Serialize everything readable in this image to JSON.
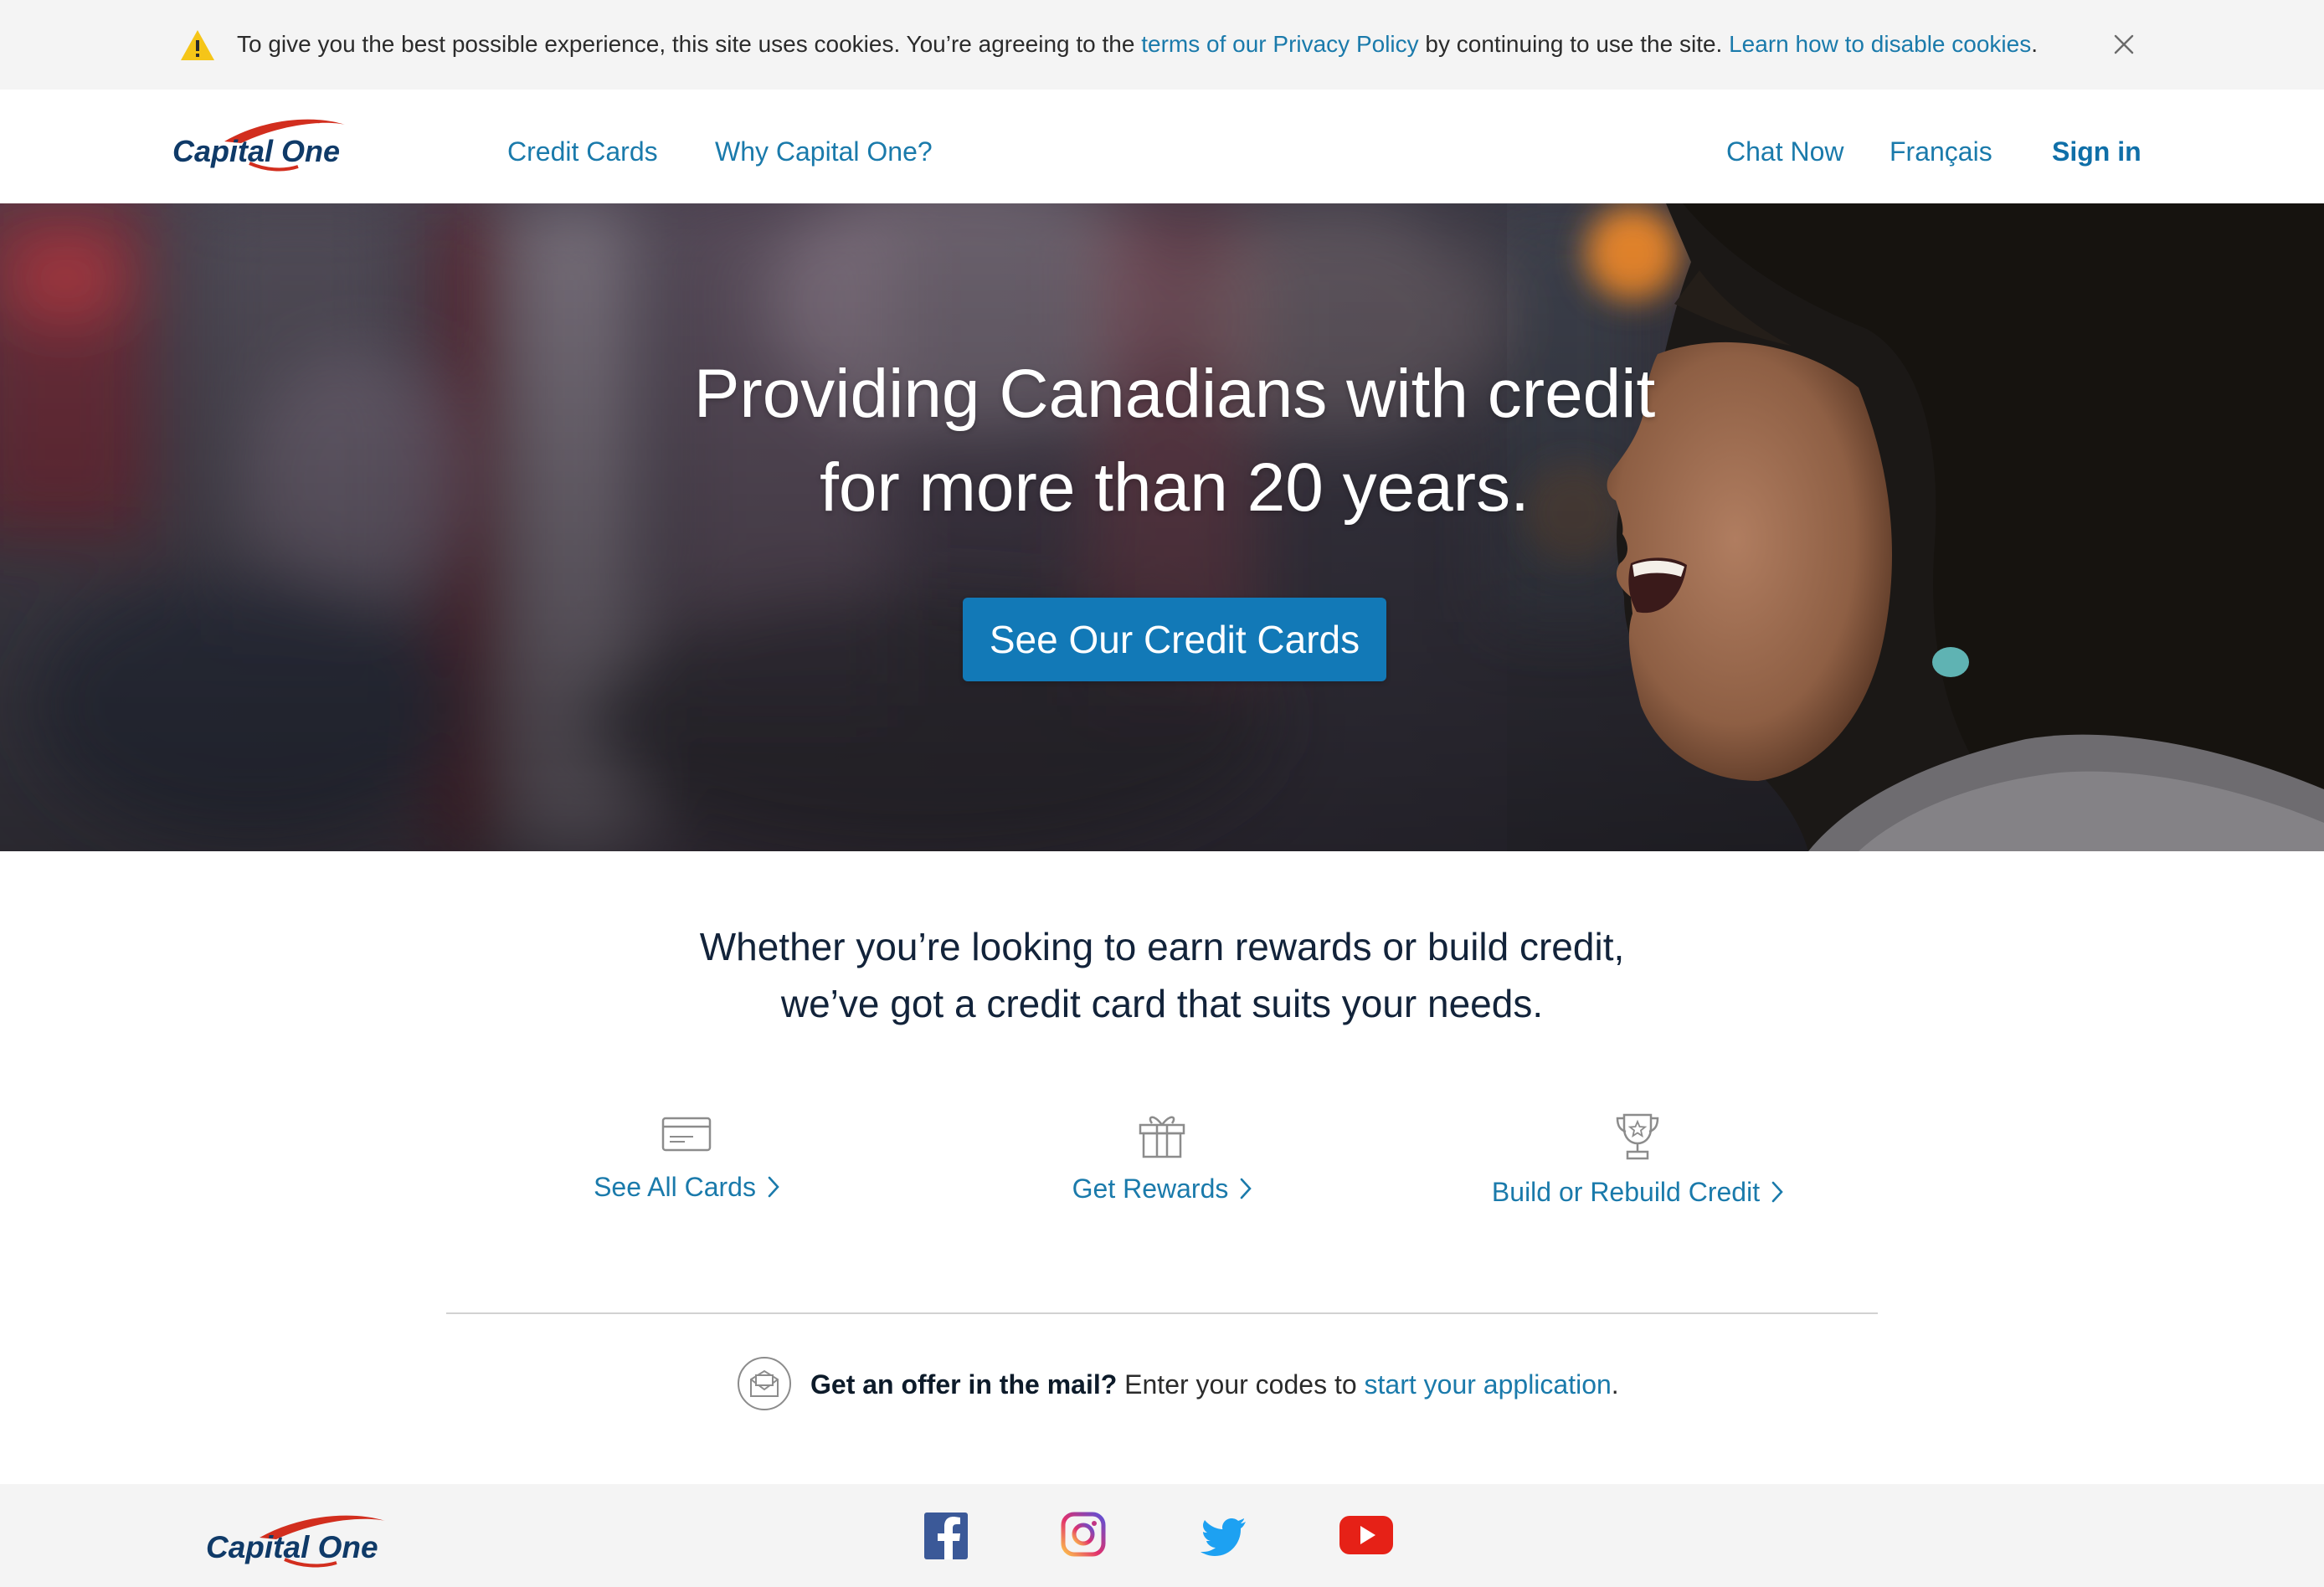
{
  "cookie_banner": {
    "text_before": "To give you the best possible experience, this site uses cookies. You’re agreeing to the ",
    "privacy_link": "terms of our Privacy Policy",
    "text_middle": " by continuing to use the site. ",
    "disable_link": "Learn how to disable cookies",
    "text_end": "."
  },
  "header": {
    "logo_text": "Capital One",
    "nav": {
      "credit_cards": "Credit Cards",
      "why_capital_one": "Why Capital One?"
    },
    "utility": {
      "chat_now": "Chat Now",
      "language": "Français",
      "sign_in": "Sign in"
    }
  },
  "hero": {
    "title_line1": "Providing Canadians with credit",
    "title_line2": "for more than 20 years.",
    "cta": "See Our Credit Cards"
  },
  "intro": {
    "line1": "Whether you’re looking to earn rewards or build credit,",
    "line2": "we’ve got a credit card that suits your needs."
  },
  "features": [
    {
      "label": "See All Cards",
      "icon": "credit-card-icon"
    },
    {
      "label": "Get Rewards",
      "icon": "gift-icon"
    },
    {
      "label": "Build or Rebuild Credit",
      "icon": "trophy-icon"
    }
  ],
  "offer": {
    "bold": "Get an offer in the mail?",
    "text": " Enter your codes to ",
    "link": "start your application",
    "end": "."
  },
  "footer": {
    "logo_text": "Capital One",
    "social": [
      "facebook-icon",
      "instagram-icon",
      "twitter-icon",
      "youtube-icon"
    ]
  },
  "colors": {
    "link": "#1a7aab",
    "cta": "#1279b7",
    "logo_navy": "#0f3a68",
    "logo_red": "#d22e1e"
  }
}
